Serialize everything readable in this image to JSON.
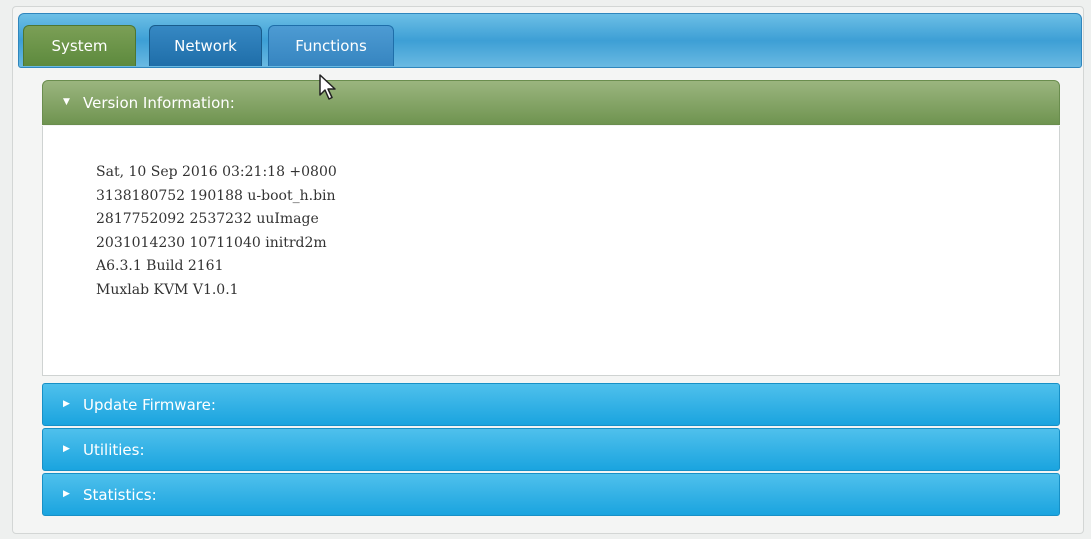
{
  "tabs": [
    {
      "label": "System",
      "active": true
    },
    {
      "label": "Network",
      "active": false
    },
    {
      "label": "Functions",
      "active": false
    }
  ],
  "panels": {
    "version_information": {
      "title": "Version Information:",
      "expanded": true,
      "lines": [
        "Sat, 10 Sep 2016 03:21:18 +0800",
        "3138180752 190188 u-boot_h.bin",
        "2817752092 2537232 uuImage",
        "2031014230 10711040 initrd2m",
        "A6.3.1 Build 2161",
        "Muxlab KVM V1.0.1"
      ]
    },
    "update_firmware": {
      "title": "Update Firmware:",
      "expanded": false
    },
    "utilities": {
      "title": "Utilities:",
      "expanded": false
    },
    "statistics": {
      "title": "Statistics:",
      "expanded": false
    }
  },
  "icons": {
    "expanded_arrow": "triangle-down-icon",
    "collapsed_arrow": "triangle-right-icon",
    "pointer": "mouse-pointer-icon"
  },
  "colors": {
    "active_tab": "#5d8a3d",
    "tab": "#1f6ea9",
    "tabbar": "#3d9fd5",
    "expanded_header": "#7a9b5b",
    "collapsed_header": "#1aa4df"
  }
}
